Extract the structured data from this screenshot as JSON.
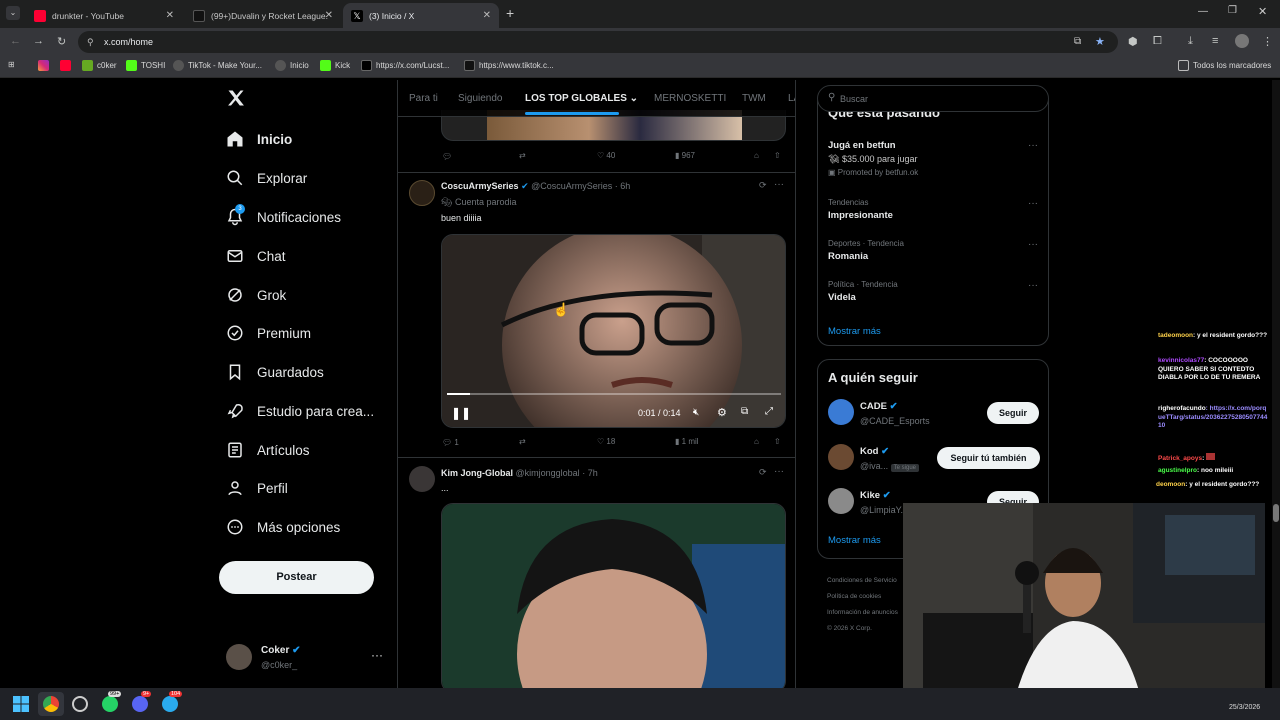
{
  "browser": {
    "tabs": [
      {
        "label": "drunkter - YouTube",
        "color": "#ff0033"
      },
      {
        "label": "(99+)Duvalin y Rocket League.",
        "color": "#111111"
      },
      {
        "label": "(3) Inicio / X",
        "color": "#000000"
      }
    ],
    "url": "x.com/home",
    "bookmarks": [
      "c0ker",
      "TOSHI",
      "TikTok - Make Your...",
      "Inicio",
      "Kick",
      "https://x.com/Lucst...",
      "https://www.tiktok.c..."
    ],
    "all_bookmarks": "Todos los marcadores"
  },
  "nav": {
    "items": [
      {
        "label": "Inicio",
        "icon": "home-icon"
      },
      {
        "label": "Explorar",
        "icon": "search-icon"
      },
      {
        "label": "Notificaciones",
        "icon": "bell-icon",
        "badge": "3"
      },
      {
        "label": "Chat",
        "icon": "mail-icon"
      },
      {
        "label": "Grok",
        "icon": "grok-icon"
      },
      {
        "label": "Premium",
        "icon": "premium-icon"
      },
      {
        "label": "Guardados",
        "icon": "bookmark-icon"
      },
      {
        "label": "Estudio para crea...",
        "icon": "rocket-icon"
      },
      {
        "label": "Artículos",
        "icon": "article-icon"
      },
      {
        "label": "Perfil",
        "icon": "person-icon"
      },
      {
        "label": "Más opciones",
        "icon": "more-icon"
      }
    ],
    "post_button": "Postear",
    "account": {
      "name": "Coker",
      "handle": "@c0ker_"
    }
  },
  "feed": {
    "tabs": [
      "Para ti",
      "Siguiendo",
      "LOS TOP GLOBALES",
      "MERNOSKETTI",
      "TWM",
      "LA"
    ],
    "prev_post_stats": {
      "likes": "40",
      "views": "967"
    },
    "post1": {
      "name": "CoscuArmySeries",
      "handle": "@CoscuArmySeries",
      "time": "· 6h",
      "parody": "Cuenta parodia",
      "text": "buen diiiia",
      "video_time": "0:01 / 0:14",
      "video_progress": 0.07,
      "replies": "1",
      "likes": "18",
      "views": "1 mil"
    },
    "post2": {
      "name": "Kim Jong-Global",
      "handle": "@kimjongglobal",
      "time": "· 7h",
      "text": "..."
    }
  },
  "right": {
    "search_placeholder": "Buscar",
    "happening_title": "Qué está pasando",
    "promo": {
      "title": "Jugá en betfun",
      "text": "$35.000 para jugar",
      "by": "Promoted by betfun.ok"
    },
    "trends": [
      {
        "context": "Tendencias",
        "name": "Impresionante"
      },
      {
        "context": "Deportes · Tendencia",
        "name": "Romania"
      },
      {
        "context": "Política · Tendencia",
        "name": "Videla"
      }
    ],
    "show_more": "Mostrar más",
    "follow_title": "A quién seguir",
    "follow": [
      {
        "name": "CADE",
        "handle": "@CADE_Esports",
        "button": "Seguir"
      },
      {
        "name": "Kod",
        "handle": "@iva...",
        "tag": "Te sigue",
        "button": "Seguir tú también"
      },
      {
        "name": "Kike",
        "handle": "@LimpiaY...",
        "button": "Seguir"
      }
    ],
    "show_more2": "Mostrar más",
    "footer": [
      "Condiciones de Servicio",
      "Política de cookies",
      "Información de anuncios",
      "© 2026 X Corp."
    ]
  },
  "chat": [
    {
      "user": "tadeomoon",
      "color": "#ffd24a",
      "msg": ": y el resident gordo???"
    },
    {
      "user": "kevinnicolas77",
      "color": "#b04bff",
      "msg": ": COCOOOOO QUIERO SABER SI CONTEDTO DIABLA POR LO DE TU REMERA"
    },
    {
      "user": "righerofacundo",
      "color": "#ffffff",
      "msg": ": https://x.com/porqueTTarg/status/2036227528050774410"
    },
    {
      "user": "Patrick_apoys",
      "color": "#ff4a4a",
      "msg": ":"
    },
    {
      "user": "agustinelpro",
      "color": "#4aff4a",
      "msg": ": noo mileiii"
    },
    {
      "user": "deomoon",
      "color": "#ffd24a",
      "msg": ": y el resident gordo???"
    }
  ],
  "taskbar": {
    "date": "25/3/2026",
    "badges": [
      "99+",
      "9+",
      "104"
    ]
  }
}
